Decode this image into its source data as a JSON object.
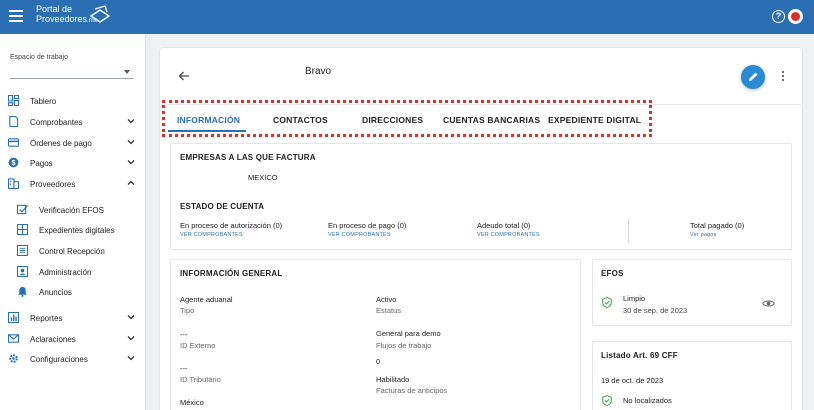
{
  "app": {
    "logo_line1": "Portal de",
    "logo_line2": "Proveedores",
    "logo_suffix": ".mx",
    "accent": "#2a6fb3",
    "topbar_color": "#2a6fb3",
    "highlight_color": "#d9302c"
  },
  "sidebar": {
    "workspace_label": "Espacio de trabajo",
    "workspace_value": "",
    "items": [
      {
        "label": "Tablero",
        "icon": "dashboard-icon",
        "chevron": ""
      },
      {
        "label": "Comprobantes",
        "icon": "document-icon",
        "chevron": "down"
      },
      {
        "label": "Órdenes de pago",
        "icon": "credit-card-icon",
        "chevron": "down"
      },
      {
        "label": "Pagos",
        "icon": "dollar-icon",
        "chevron": "down"
      },
      {
        "label": "Proveedores",
        "icon": "business-icon",
        "chevron": "up"
      },
      {
        "label": "Verificación EFOS",
        "icon": "verified-icon",
        "chevron": ""
      },
      {
        "label": "Expedientes digitales",
        "icon": "grid-icon",
        "chevron": ""
      },
      {
        "label": "Control Recepción",
        "icon": "list-icon",
        "chevron": ""
      },
      {
        "label": "Administración",
        "icon": "admin-icon",
        "chevron": ""
      },
      {
        "label": "Anuncios",
        "icon": "bell-icon",
        "chevron": ""
      },
      {
        "label": "Reportes",
        "icon": "chart-icon",
        "chevron": "down"
      },
      {
        "label": "Aclaraciones",
        "icon": "mail-icon",
        "chevron": "down"
      },
      {
        "label": "Configuraciones",
        "icon": "gear-icon",
        "chevron": "down"
      }
    ]
  },
  "header": {
    "provider_name": "Bravo"
  },
  "tabs": [
    {
      "label": "INFORMACIÓN",
      "active": true
    },
    {
      "label": "CONTACTOS",
      "active": false
    },
    {
      "label": "DIRECCIONES",
      "active": false
    },
    {
      "label": "CUENTAS BANCARIAS",
      "active": false
    },
    {
      "label": "EXPEDIENTE DIGITAL",
      "active": false
    }
  ],
  "invoicing": {
    "title": "EMPRESAS A LAS QUE FACTURA",
    "company": "MEXICO"
  },
  "account_status": {
    "title": "ESTADO DE CUENTA",
    "items": [
      {
        "label": "En proceso de autorización (0)",
        "link": "VER COMPROBANTES"
      },
      {
        "label": "En proceso de pago (0)",
        "link": "VER COMPROBANTES"
      },
      {
        "label": "Adeudo total (0)",
        "link": "VER COMPROBANTES"
      },
      {
        "label": "Total pagado (0)",
        "link": "Ver pagos"
      }
    ]
  },
  "general_info": {
    "title": "INFORMACIÓN GENERAL",
    "left": [
      {
        "value": "Agente aduanal",
        "label": "Tipo"
      },
      {
        "value": "---",
        "label": "ID Externo"
      },
      {
        "value": "---",
        "label": "ID Tributario"
      },
      {
        "value": "México",
        "label": ""
      }
    ],
    "right": [
      {
        "value": "Activo",
        "label": "Estatus"
      },
      {
        "value": "General para demo",
        "label": "Flujos de trabajo"
      },
      {
        "value": "0",
        "label": ""
      },
      {
        "value": "Habilitado",
        "label": "Facturas de anticipos"
      }
    ]
  },
  "efos": {
    "title": "EFOS",
    "status": "Limpio",
    "date": "30 de sep. de 2023"
  },
  "art69": {
    "title": "Listado Art. 69 CFF",
    "date": "19 de oct. de 2023",
    "status": "No localizados"
  }
}
